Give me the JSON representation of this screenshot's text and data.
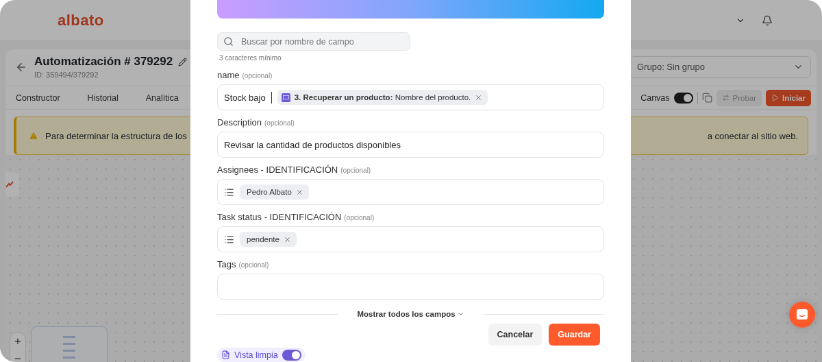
{
  "header": {
    "logo": "albato"
  },
  "automation": {
    "title": "Automatización # 379292",
    "id": "ID: 359494/379292",
    "group_select": "Grupo: Sin grupo"
  },
  "tabs": [
    {
      "label": "Constructor"
    },
    {
      "label": "Historial"
    },
    {
      "label": "Analítica"
    }
  ],
  "toolbar": {
    "canvas_label": "Canvas",
    "canvas_on": true,
    "test_button": {
      "label": "Probar",
      "disabled": true
    },
    "start_button": {
      "label": "Iniciar",
      "disabled": false
    }
  },
  "warning": {
    "text_left": "Para determinar la estructura de los",
    "text_right": "a conectar al sitio web."
  },
  "zoom_controls": [
    "+",
    "−"
  ],
  "modal": {
    "search": {
      "placeholder": "Buscar por nombre de campo",
      "hint": "3 caracteres mínimo"
    },
    "fields": [
      {
        "kind": "mapped",
        "label": "name",
        "hint": "(opcional)",
        "value": "Stock bajo",
        "tokens": [
          "**3. Recuperar un producto:** Nombre del producto."
        ]
      },
      {
        "kind": "text",
        "label": "Description",
        "hint": "(opcional)",
        "value": "Revisar la cantidad de productos disponibles"
      },
      {
        "kind": "list",
        "label": "Assignees - IDENTIFICACIÓN",
        "hint": "(opcional)",
        "chips": [
          "Pedro Albato"
        ]
      },
      {
        "kind": "list",
        "label": "Task status - IDENTIFICACIÓN",
        "hint": "(opcional)",
        "chips": [
          "pendente"
        ]
      },
      {
        "kind": "text",
        "label": "Tags",
        "hint": "(opcional)"
      }
    ],
    "show_all": "Mostrar todos los campos",
    "cancel_button": "Cancelar",
    "save_button": "Guardar",
    "clean_view": {
      "label": "Vista limpia",
      "on": true
    }
  }
}
